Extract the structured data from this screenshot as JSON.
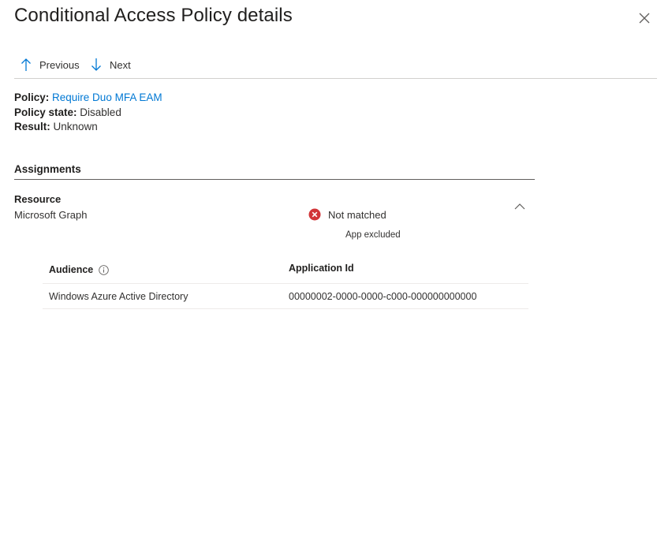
{
  "header": {
    "title": "Conditional Access Policy details",
    "close_icon": "close-icon"
  },
  "toolbar": {
    "previous_label": "Previous",
    "next_label": "Next",
    "previous_icon": "arrow-up-icon",
    "next_icon": "arrow-down-icon"
  },
  "policy": {
    "policy_label": "Policy:",
    "policy_name": "Require Duo MFA EAM",
    "state_label": "Policy state:",
    "state_value": "Disabled",
    "result_label": "Result:",
    "result_value": "Unknown"
  },
  "assignments": {
    "title": "Assignments",
    "resource_label": "Resource",
    "resource_value": "Microsoft Graph",
    "status": "Not matched",
    "status_icon": "error-circle-icon",
    "status_color": "#d13438",
    "status_detail": "App excluded",
    "collapse_icon": "chevron-up-icon",
    "table": {
      "columns": [
        "Audience",
        "Application Id"
      ],
      "info_icon": "info-icon",
      "rows": [
        {
          "audience": "Windows Azure Active Directory",
          "application_id": "00000002-0000-0000-c000-000000000000"
        }
      ]
    }
  },
  "colors": {
    "accent": "#0078d4",
    "text": "#323130",
    "divider": "#d2d0ce"
  }
}
